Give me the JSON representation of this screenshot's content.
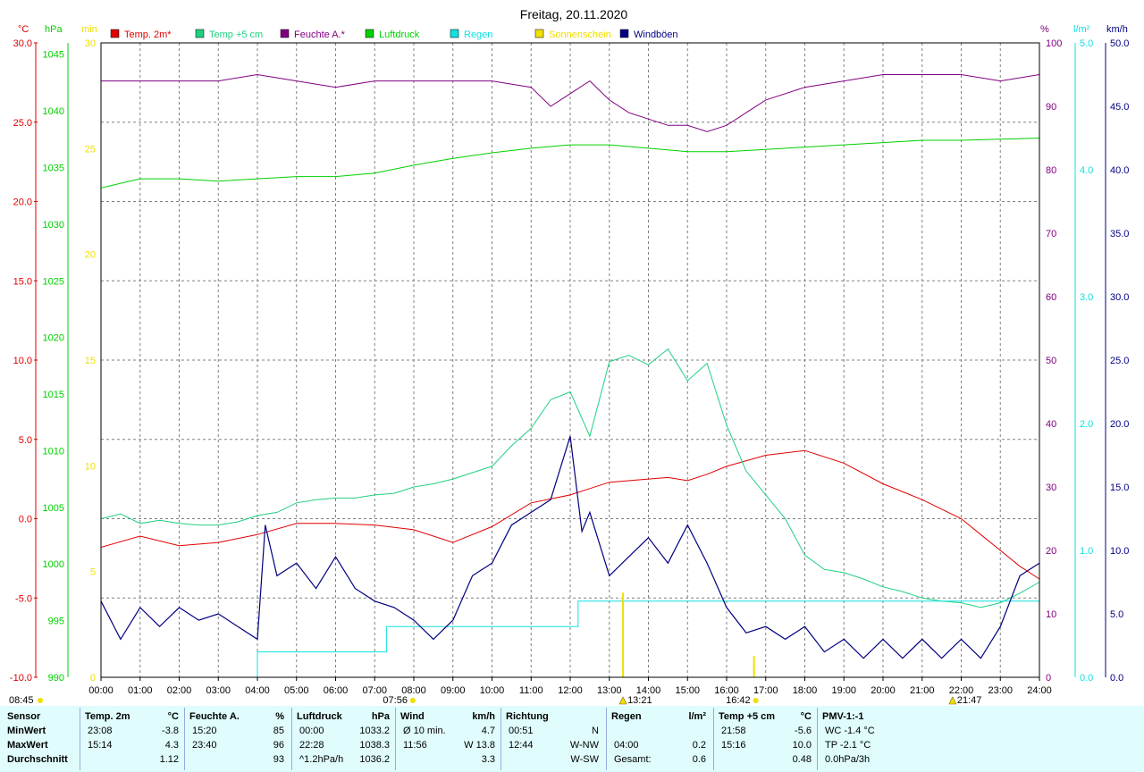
{
  "title": "Freitag, 20.11.2020",
  "colors": {
    "temp2m": "#e00000",
    "temp5cm": "#20d080",
    "humidity": "#800080",
    "pressure": "#00d000",
    "rain": "#10e0e0",
    "sunshine": "#f0e000",
    "gusts": "#000080",
    "grid": "#808080"
  },
  "chart_data": {
    "type": "line",
    "title": "Freitag, 20.11.2020",
    "x_range_hours": [
      0,
      24
    ],
    "x_tick_labels": [
      "00:00",
      "01:00",
      "02:00",
      "03:00",
      "04:00",
      "05:00",
      "06:00",
      "07:00",
      "08:00",
      "09:00",
      "10:00",
      "11:00",
      "12:00",
      "13:00",
      "14:00",
      "15:00",
      "16:00",
      "17:00",
      "18:00",
      "19:00",
      "20:00",
      "21:00",
      "22:00",
      "23:00",
      "24:00"
    ],
    "axes": {
      "temp_c": {
        "unit": "°C",
        "range": [
          -10,
          30
        ],
        "ticks": [
          "30.0",
          "25.0",
          "20.0",
          "15.0",
          "10.0",
          "5.0",
          "0.0",
          "-5.0",
          "-10.0"
        ]
      },
      "pressure_hpa": {
        "unit": "hPa",
        "range": [
          990,
          1046
        ],
        "ticks": [
          "1045",
          "1040",
          "1035",
          "1030",
          "1025",
          "1020",
          "1015",
          "1010",
          "1005",
          "1000",
          "995",
          "990"
        ]
      },
      "sunshine_min": {
        "unit": "min",
        "range": [
          0,
          30
        ],
        "ticks": [
          "30",
          "25",
          "20",
          "15",
          "10",
          "5",
          "0"
        ]
      },
      "humidity_pct": {
        "unit": "%",
        "range": [
          0,
          100
        ],
        "ticks": [
          "100",
          "90",
          "80",
          "70",
          "60",
          "50",
          "40",
          "30",
          "20",
          "10",
          "0"
        ]
      },
      "rain_lm2": {
        "unit": "l/m²",
        "range": [
          0,
          5
        ],
        "ticks": [
          "5.0",
          "4.0",
          "3.0",
          "2.0",
          "1.0",
          "0.0"
        ]
      },
      "wind_kmh": {
        "unit": "km/h",
        "range": [
          0,
          50
        ],
        "ticks": [
          "50.0",
          "45.0",
          "40.0",
          "35.0",
          "30.0",
          "25.0",
          "20.0",
          "15.0",
          "10.0",
          "5.0",
          "0.0"
        ]
      }
    },
    "legend": [
      "Temp. 2m*",
      "Temp +5 cm",
      "Feuchte A.*",
      "Luftdruck",
      "Regen",
      "Sonnenschein",
      "Windböen"
    ],
    "series": [
      {
        "name": "Temp. 2m*",
        "axis": "temp_c",
        "x": [
          0,
          1,
          2,
          3,
          4,
          5,
          6,
          7,
          8,
          9,
          10,
          11,
          12,
          12.5,
          13,
          14,
          14.5,
          15,
          15.5,
          16,
          17,
          18,
          19,
          20,
          21,
          22,
          22.5,
          23,
          23.5,
          24
        ],
        "y": [
          -1.8,
          -1.1,
          -1.7,
          -1.5,
          -1.0,
          -0.3,
          -0.3,
          -0.4,
          -0.7,
          -1.5,
          -0.5,
          1.0,
          1.5,
          1.9,
          2.3,
          2.5,
          2.6,
          2.4,
          2.8,
          3.3,
          4.0,
          4.3,
          3.5,
          2.2,
          1.2,
          0.0,
          -1.0,
          -2.0,
          -3.0,
          -3.8
        ]
      },
      {
        "name": "Feuchte A.*",
        "axis": "humidity_pct",
        "x": [
          0,
          1,
          2,
          3,
          4,
          5,
          6,
          7,
          8,
          9,
          10,
          11,
          11.5,
          12,
          12.5,
          13,
          13.5,
          14,
          14.5,
          15,
          15.5,
          16,
          16.5,
          17,
          18,
          19,
          20,
          21,
          22,
          23,
          24
        ],
        "y": [
          94,
          94,
          94,
          94,
          95,
          94,
          93,
          94,
          94,
          94,
          94,
          93,
          90,
          92,
          94,
          91,
          89,
          88,
          87,
          87,
          86,
          87,
          89,
          91,
          93,
          94,
          95,
          95,
          95,
          94,
          95
        ]
      },
      {
        "name": "Luftdruck",
        "axis": "pressure_hpa",
        "x": [
          0,
          1,
          2,
          3,
          4,
          5,
          6,
          7,
          8,
          9,
          10,
          11,
          12,
          13,
          14,
          15,
          16,
          17,
          18,
          19,
          20,
          21,
          22,
          23,
          24
        ],
        "y": [
          1033.2,
          1034.0,
          1034.0,
          1033.8,
          1034.0,
          1034.2,
          1034.2,
          1034.5,
          1035.2,
          1035.8,
          1036.3,
          1036.7,
          1037.0,
          1037.0,
          1036.7,
          1036.4,
          1036.4,
          1036.6,
          1036.8,
          1037.0,
          1037.2,
          1037.4,
          1037.4,
          1037.5,
          1037.6
        ]
      },
      {
        "name": "Temp +5 cm",
        "axis": "temp_c",
        "x": [
          0,
          0.5,
          1,
          1.5,
          2,
          2.5,
          3,
          3.5,
          4,
          4.5,
          5,
          5.5,
          6,
          6.5,
          7,
          7.5,
          8,
          8.5,
          9,
          9.5,
          10,
          10.5,
          11,
          11.5,
          12,
          12.5,
          13,
          13.5,
          14,
          14.5,
          15,
          15.5,
          16,
          16.5,
          17,
          17.5,
          18,
          18.5,
          19,
          19.5,
          20,
          20.5,
          21,
          21.5,
          22,
          22.5,
          23,
          23.5,
          24
        ],
        "y": [
          0.0,
          0.3,
          -0.3,
          -0.1,
          -0.3,
          -0.4,
          -0.4,
          -0.2,
          0.2,
          0.4,
          1.0,
          1.2,
          1.3,
          1.3,
          1.5,
          1.6,
          2.0,
          2.2,
          2.5,
          2.9,
          3.3,
          4.6,
          5.7,
          7.5,
          8.0,
          5.2,
          9.9,
          10.3,
          9.7,
          10.7,
          8.7,
          9.8,
          5.9,
          3.0,
          1.5,
          0.0,
          -2.3,
          -3.2,
          -3.4,
          -3.8,
          -4.3,
          -4.6,
          -5.0,
          -5.2,
          -5.3,
          -5.6,
          -5.3,
          -4.7,
          -4.0
        ]
      },
      {
        "name": "Regen",
        "axis": "rain_lm2",
        "x": [
          0,
          4,
          4,
          7.3,
          7.3,
          12.2,
          12.2,
          24
        ],
        "y": [
          0,
          0,
          0.2,
          0.2,
          0.4,
          0.4,
          0.6,
          0.6
        ]
      },
      {
        "name": "Sonnenschein",
        "axis": "sunshine_min",
        "x": [
          13.35,
          16.7
        ],
        "y": [
          4,
          1
        ]
      },
      {
        "name": "Windböen",
        "axis": "wind_kmh",
        "x": [
          0,
          0.5,
          1,
          1.5,
          2,
          2.5,
          3,
          3.5,
          4,
          4.2,
          4.5,
          5,
          5.5,
          6,
          6.5,
          7,
          7.5,
          8,
          8.5,
          9,
          9.5,
          10,
          10.5,
          11,
          11.5,
          12,
          12.3,
          12.5,
          13,
          13.5,
          14,
          14.5,
          15,
          15.5,
          16,
          16.5,
          17,
          17.5,
          18,
          18.5,
          19,
          19.5,
          20,
          20.5,
          21,
          21.5,
          22,
          22.5,
          23,
          23.5,
          24
        ],
        "y": [
          6.0,
          3.0,
          5.5,
          4.0,
          5.5,
          4.5,
          5.0,
          4.0,
          3.0,
          12.0,
          8.0,
          9.0,
          7.0,
          9.5,
          7.0,
          6.0,
          5.5,
          4.5,
          3.0,
          4.5,
          8.0,
          9.0,
          12.0,
          13.0,
          14.0,
          19.0,
          11.5,
          13.0,
          8.0,
          9.5,
          11.0,
          9.0,
          12.0,
          9.0,
          5.5,
          3.5,
          4.0,
          3.0,
          4.0,
          2.0,
          3.0,
          1.5,
          3.0,
          1.5,
          3.0,
          1.5,
          3.0,
          1.5,
          4.0,
          8.0,
          9.0
        ]
      }
    ],
    "sun_events": [
      {
        "time": "07:56",
        "x": 7.93,
        "label": "07:56"
      },
      {
        "time": "16:42",
        "x": 16.7,
        "label": "16:42"
      }
    ],
    "markers": [
      {
        "label": "13:21",
        "x": 13.35
      },
      {
        "label": "21:47",
        "x": 21.78
      }
    ],
    "corner_label": "08:45"
  },
  "stats": {
    "columns": [
      {
        "id": "sensor",
        "header": "Sensor",
        "unit": "",
        "rows": [
          [
            "MinWert",
            ""
          ],
          [
            "MaxWert",
            ""
          ],
          [
            "Durchschnitt",
            ""
          ]
        ]
      },
      {
        "id": "temp2m",
        "header": "Temp. 2m",
        "unit": "°C",
        "rows": [
          [
            "23:08",
            "-3.8"
          ],
          [
            "15:14",
            "4.3"
          ],
          [
            "",
            "1.12"
          ]
        ]
      },
      {
        "id": "humidity",
        "header": "Feuchte A.",
        "unit": "%",
        "rows": [
          [
            "15:20",
            "85"
          ],
          [
            "23:40",
            "96"
          ],
          [
            "",
            "93"
          ]
        ]
      },
      {
        "id": "pressure",
        "header": "Luftdruck",
        "unit": "hPa",
        "rows": [
          [
            "00:00",
            "1033.2"
          ],
          [
            "22:28",
            "1038.3"
          ],
          [
            "^1.2hPa/h",
            "1036.2"
          ]
        ]
      },
      {
        "id": "wind",
        "header": "Wind",
        "unit": "km/h",
        "rows": [
          [
            "Ø 10 min.",
            "4.7"
          ],
          [
            "11:56",
            "W 13.8"
          ],
          [
            "",
            "3.3"
          ]
        ]
      },
      {
        "id": "dir",
        "header": "Richtung",
        "unit": "",
        "rows": [
          [
            "00:51",
            "N"
          ],
          [
            "12:44",
            "W-NW"
          ],
          [
            "",
            "W-SW"
          ]
        ]
      },
      {
        "id": "rain",
        "header": "Regen",
        "unit": "l/m²",
        "rows": [
          [
            "",
            ""
          ],
          [
            "04:00",
            "0.2"
          ],
          [
            "Gesamt:",
            "0.6"
          ]
        ]
      },
      {
        "id": "temp5cm",
        "header": "Temp +5 cm",
        "unit": "°C",
        "rows": [
          [
            "21:58",
            "-5.6"
          ],
          [
            "15:16",
            "10.0"
          ],
          [
            "",
            "0.48"
          ]
        ]
      },
      {
        "id": "pmv",
        "header": "PMV-1:-1",
        "unit": "",
        "rows": [
          [
            "WC -1.4 °C",
            ""
          ],
          [
            "TP -2.1 °C",
            ""
          ],
          [
            "0.0hPa/3h",
            ""
          ]
        ]
      }
    ]
  }
}
